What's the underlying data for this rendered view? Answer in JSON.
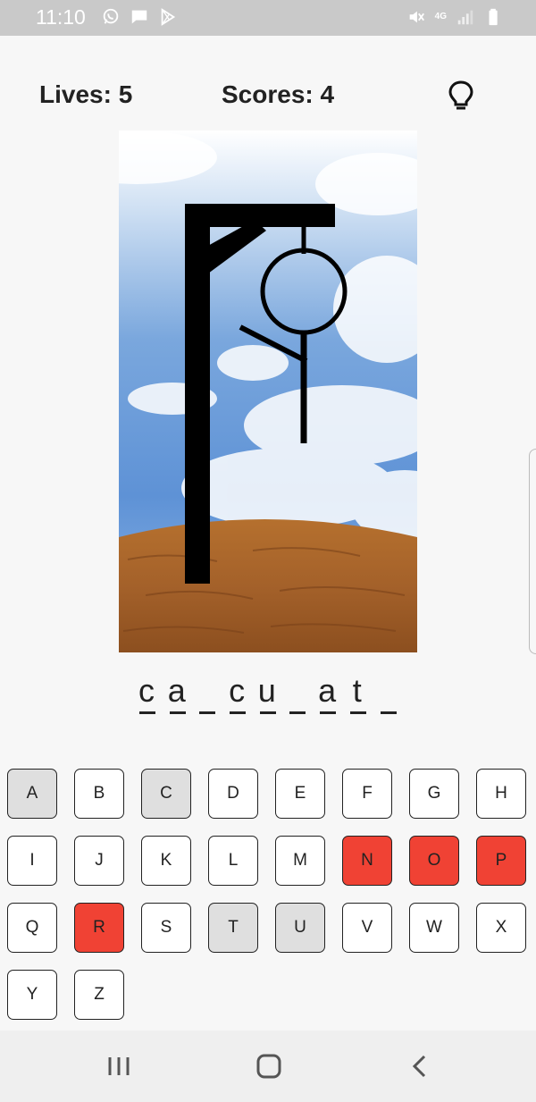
{
  "status_bar": {
    "time": "11:10",
    "left_icons": [
      "whatsapp-icon",
      "message-icon",
      "play-store-icon"
    ],
    "right_icons": [
      "mute-icon",
      "4g-data-icon",
      "signal-icon",
      "battery-icon"
    ],
    "network_label": "4G"
  },
  "header": {
    "lives": "Lives: 5",
    "scores": "Scores: 4",
    "hint_icon": "lightbulb-icon"
  },
  "word": [
    "c",
    "a",
    "",
    "c",
    "u",
    "",
    "a",
    "t",
    ""
  ],
  "keyboard": {
    "keys": [
      {
        "letter": "A",
        "state": "used"
      },
      {
        "letter": "B",
        "state": "available"
      },
      {
        "letter": "C",
        "state": "used"
      },
      {
        "letter": "D",
        "state": "available"
      },
      {
        "letter": "E",
        "state": "available"
      },
      {
        "letter": "F",
        "state": "available"
      },
      {
        "letter": "G",
        "state": "available"
      },
      {
        "letter": "H",
        "state": "available"
      },
      {
        "letter": "I",
        "state": "available"
      },
      {
        "letter": "J",
        "state": "available"
      },
      {
        "letter": "K",
        "state": "available"
      },
      {
        "letter": "L",
        "state": "available"
      },
      {
        "letter": "M",
        "state": "available"
      },
      {
        "letter": "N",
        "state": "wrong"
      },
      {
        "letter": "O",
        "state": "wrong"
      },
      {
        "letter": "P",
        "state": "wrong"
      },
      {
        "letter": "Q",
        "state": "available"
      },
      {
        "letter": "R",
        "state": "wrong"
      },
      {
        "letter": "S",
        "state": "available"
      },
      {
        "letter": "T",
        "state": "used"
      },
      {
        "letter": "U",
        "state": "used"
      },
      {
        "letter": "V",
        "state": "available"
      },
      {
        "letter": "W",
        "state": "available"
      },
      {
        "letter": "X",
        "state": "available"
      },
      {
        "letter": "Y",
        "state": "available"
      },
      {
        "letter": "Z",
        "state": "available"
      }
    ]
  },
  "colors": {
    "wrong": "#f04234",
    "used": "#dfdfdf",
    "available": "#ffffff"
  },
  "navbar": {
    "buttons": [
      "recent-apps-icon",
      "home-icon",
      "back-icon"
    ]
  }
}
